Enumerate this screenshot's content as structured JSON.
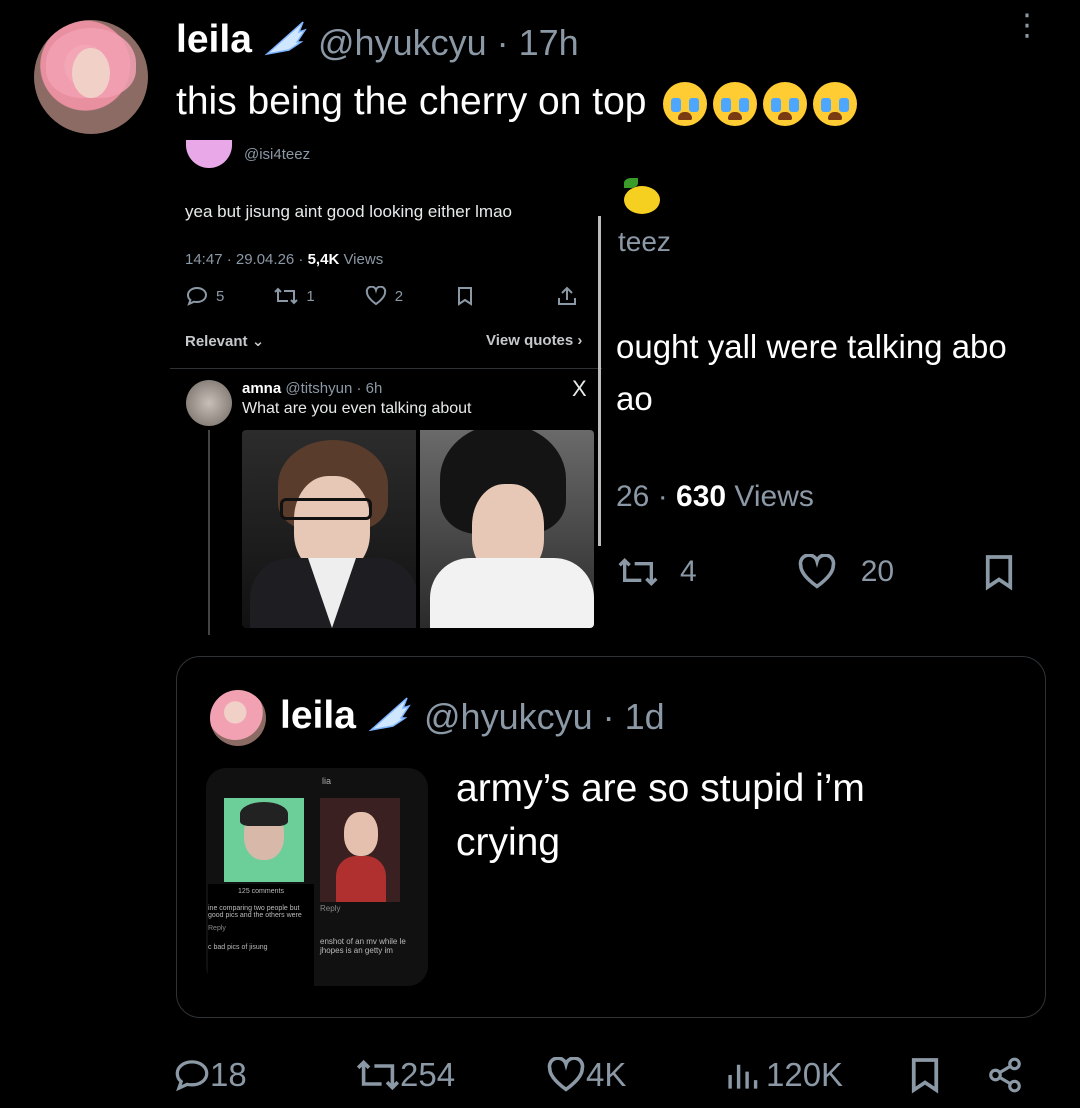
{
  "tweet": {
    "author_name": "leila",
    "author_handle": "@hyukcyu",
    "time": "· 17h",
    "text": "this being the cherry on top",
    "emoji_count": 4,
    "emoji_icon": "loudly-crying-face-icon"
  },
  "screenshot_left": {
    "top_handle": "@isi4teez",
    "post_text": "yea but jisung aint good looking either lmao",
    "meta_time": "14:47 · 29.04.26 · ",
    "meta_views_num": "5,4K",
    "meta_views_label": " Views",
    "replies": "5",
    "reposts": "1",
    "likes": "2",
    "relevant_label": "Relevant",
    "view_quotes_label": "View quotes",
    "reply_name": "amna",
    "reply_handle": "@titshyun · 6h",
    "reply_text": "What are you even talking about",
    "x_icon": "X"
  },
  "screenshot_right": {
    "handle_fragment": "teez",
    "text_line1": "ought yall were talking abo",
    "text_line2": "ao",
    "meta_date": "26 · ",
    "meta_views_num": "630",
    "meta_views_label": " Views",
    "reposts": "4",
    "likes": "20"
  },
  "quoted": {
    "author_name": "leila",
    "author_handle": "@hyukcyu · 1d",
    "text": "army’s are so stupid i’m crying",
    "media": {
      "left_comments": "125 comments",
      "left_reply_text": "ine comparing two people but good pics and the others were",
      "left_reply": "Reply",
      "left_reply_text2": "c bad pics of jisung",
      "right_header": "lia",
      "right_reply": "Reply",
      "right_text": "enshot of an mv while le jhopes is an getty im"
    }
  },
  "actions": {
    "replies": "18",
    "reposts": "254",
    "likes": "4K",
    "views": "120K"
  },
  "colors": {
    "background": "#000000",
    "text": "#e7e9ea",
    "muted": "#8b98a5",
    "border": "#2f3336"
  }
}
